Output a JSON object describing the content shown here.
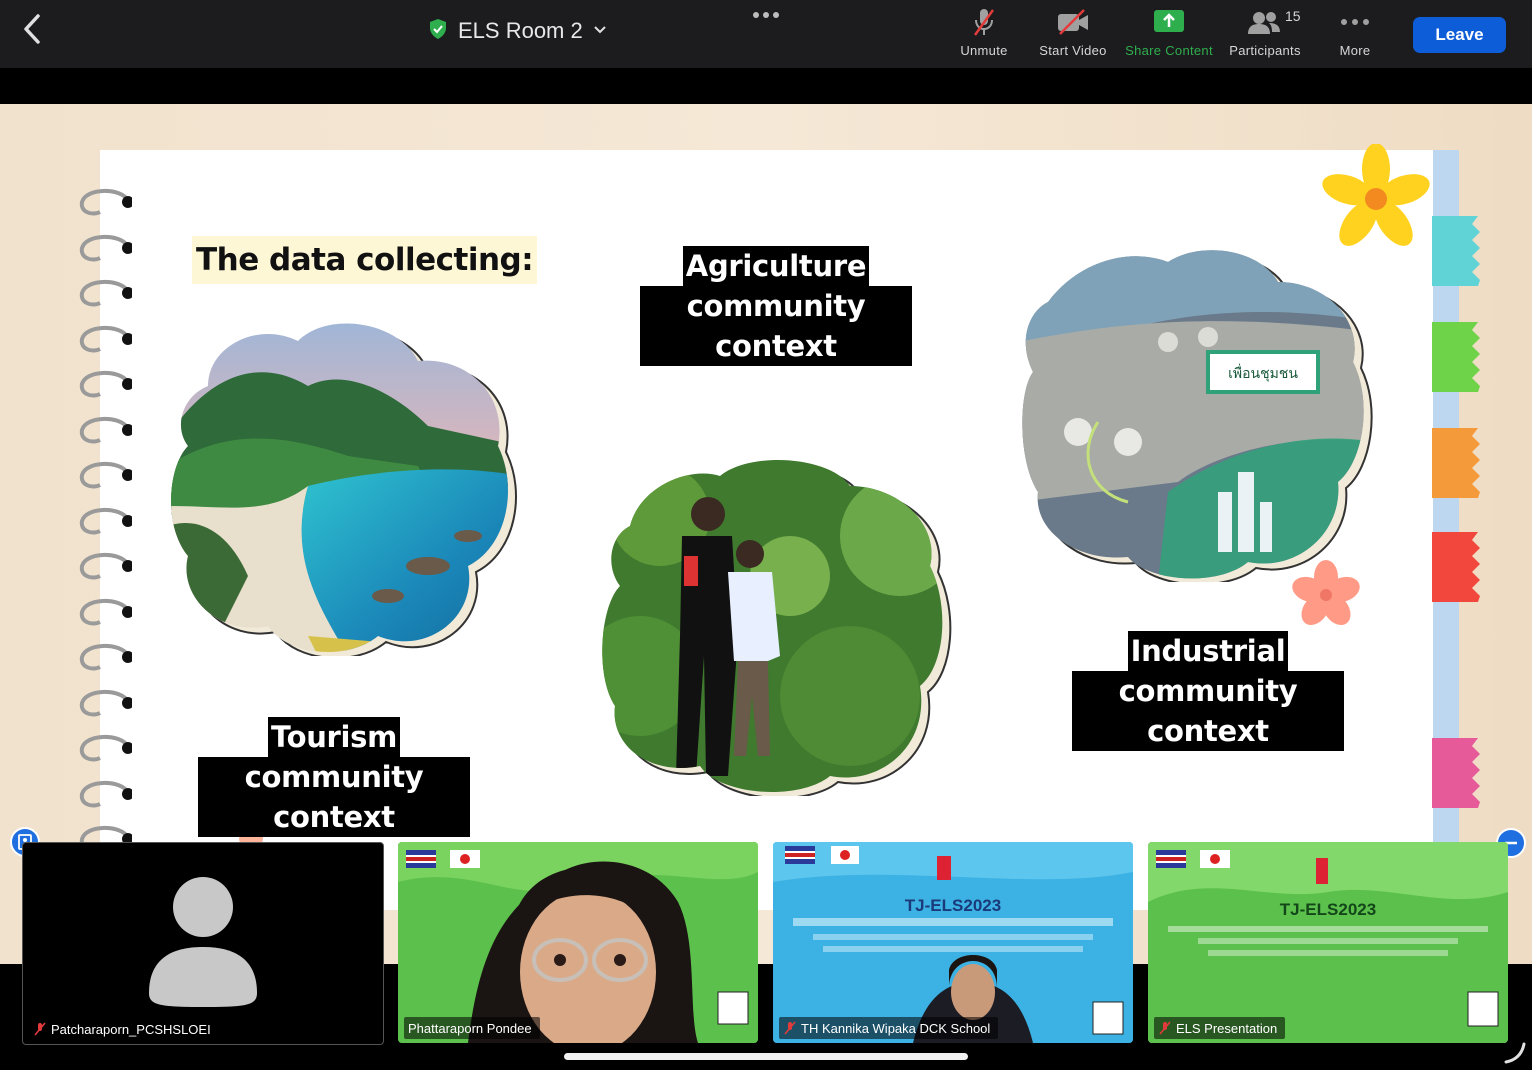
{
  "meeting": {
    "room_name": "ELS Room 2",
    "participant_count": "15"
  },
  "toolbar": {
    "unmute": "Unmute",
    "start_video": "Start Video",
    "share_content": "Share Content",
    "participants": "Participants",
    "more": "More",
    "leave": "Leave"
  },
  "slide": {
    "heading": "The data collecting:",
    "agriculture": [
      "Agriculture",
      "community context"
    ],
    "tourism": [
      "Tourism",
      "community context"
    ],
    "industrial": [
      "Industrial",
      "community context"
    ],
    "sign_text": "เพื่อนชุมชน"
  },
  "participants": [
    {
      "name": "Patcharaporn_PCSHSLOEI",
      "muted": true,
      "video": false
    },
    {
      "name": "Phattaraporn Pondee",
      "muted": false,
      "video": true
    },
    {
      "name": "TH  Kannika Wipaka DCK School",
      "muted": true,
      "video": true
    },
    {
      "name": "ELS Presentation",
      "muted": true,
      "video": true
    }
  ],
  "event_banner": {
    "title": "TJ-ELS2023"
  },
  "colors": {
    "leave": "#0e5dd8",
    "share_green": "#2fae4e",
    "topbar": "#1c1c1e",
    "tab_teal": "#5fd3d6",
    "tab_green": "#6fd34a",
    "tab_orange": "#f59a3a",
    "tab_red": "#f2473c",
    "tab_pink": "#e65a9a"
  }
}
